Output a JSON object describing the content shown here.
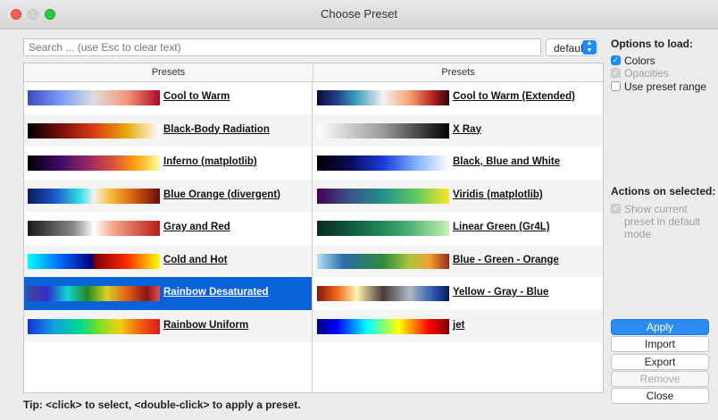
{
  "window": {
    "title": "Choose Preset"
  },
  "search": {
    "placeholder": "Search ... (use Esc to clear text)",
    "value": ""
  },
  "mode_combo": {
    "value": "default"
  },
  "table": {
    "headers": [
      "Presets",
      "Presets"
    ],
    "rows": [
      [
        {
          "name": "Cool to Warm",
          "gradient": "linear-gradient(90deg,#3b4cc0,#7a9af8 25%,#dddddd 50%,#f4987a 75%,#b40426)"
        },
        {
          "name": "Cool to Warm (Extended)",
          "gradient": "linear-gradient(90deg,#0a0a3a,#1f3f8c 15%,#3fa0b8 30%,#f2f2f2 50%,#f7a271 70%,#b22222 88%,#300008)"
        }
      ],
      [
        {
          "name": "Black-Body Radiation",
          "gradient": "linear-gradient(90deg,#000000,#7a0d0d 25%,#d93b12 50%,#e8a80a 75%,#ffffff)"
        },
        {
          "name": "X Ray",
          "gradient": "linear-gradient(90deg,#ffffff,#9a9a9a 50%,#000000)"
        }
      ],
      [
        {
          "name": "Inferno (matplotlib)",
          "gradient": "linear-gradient(90deg,#000004,#420a68 25%,#932667 45%,#dd513a 65%,#fca50a 82%,#fcffa4)"
        },
        {
          "name": "Black, Blue and White",
          "gradient": "linear-gradient(90deg,#000000,#0a0a5a 25%,#1a3ad8 50%,#7fb0ff 75%,#ffffff)"
        }
      ],
      [
        {
          "name": "Blue Orange (divergent)",
          "gradient": "linear-gradient(90deg,#0b1a5a,#1a55c8 20%,#33e0e8 40%,#f2f2f2 50%,#f5c040 62%,#e06a10 78%,#6a0a0a)"
        },
        {
          "name": "Viridis (matplotlib)",
          "gradient": "linear-gradient(90deg,#440154,#3b528b 25%,#21918c 50%,#5ec962 75%,#fde725)"
        }
      ],
      [
        {
          "name": "Gray and Red",
          "gradient": "linear-gradient(90deg,#1a1a1a,#8a8a8a 35%,#ffffff 50%,#f2a58a 65%,#c01818)"
        },
        {
          "name": "Linear Green (Gr4L)",
          "gradient": "linear-gradient(90deg,#0a2a22,#146b4a 35%,#3aa86a 65%,#c8f0b0)"
        }
      ],
      [
        {
          "name": "Cold and Hot",
          "gradient": "linear-gradient(90deg,#00ffff,#0066ff 25%,#000080 48%,#8a0000 52%,#ff2a00 75%,#ffff00)"
        },
        {
          "name": "Blue - Green - Orange",
          "gradient": "linear-gradient(90deg,#b6e2f4,#2a6aa8 20%,#2e8a3a 50%,#a8c83a 70%,#f0a030 85%,#9a2a1a)"
        }
      ],
      [
        {
          "name": "Rainbow Desaturated",
          "gradient": "linear-gradient(90deg,#474798,#2e2ec8 15%,#13d4d4 30%,#228a22 45%,#d4d420 60%,#e0601c 75%,#8a1414 90%,#e05050)",
          "selected": true
        },
        {
          "name": "Yellow - Gray - Blue",
          "gradient": "linear-gradient(90deg,#7a1a08,#f26418 15%,#fff3b0 30%,#4a3a3a 50%,#b0b8c4 70%,#2a5ab0 88%,#0a1a5a)"
        }
      ],
      [
        {
          "name": "Rainbow Uniform",
          "gradient": "linear-gradient(90deg,#1a30d8,#10a0e0 20%,#00d890 40%,#80e020 55%,#f0d010 70%,#f06010 85%,#e01818)"
        },
        {
          "name": "jet",
          "gradient": "linear-gradient(90deg,#00007f,#0000ff 15%,#00ffff 38%,#7fff7f 50%,#ffff00 62%,#ff0000 85%,#7f0000)"
        }
      ]
    ]
  },
  "tip": "Tip: <click> to select, <double-click> to apply a preset.",
  "options": {
    "heading": "Options to load:",
    "colors": "Colors",
    "opacities": "Opacities",
    "use_range": "Use preset range"
  },
  "actions": {
    "heading": "Actions on selected:",
    "show_current": "Show current preset in default mode"
  },
  "buttons": {
    "apply": "Apply",
    "import": "Import",
    "export": "Export",
    "remove": "Remove",
    "close": "Close"
  }
}
